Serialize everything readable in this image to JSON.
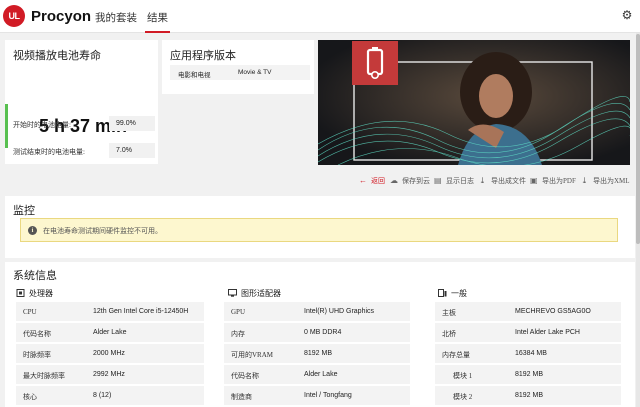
{
  "header": {
    "logo_text": "UL",
    "brand": "Procyon",
    "nav": [
      "我的套装",
      "结果"
    ],
    "settings_icon": "gear-icon"
  },
  "battery": {
    "title": "视频播放电池寿命",
    "value": "5 h 37 min",
    "rows": [
      {
        "label": "开始时的电池电量:",
        "value": "99.0%"
      },
      {
        "label": "测试结束时的电池电量:",
        "value": "7.0%"
      }
    ]
  },
  "app_version": {
    "title": "应用程序版本",
    "row": {
      "label": "电影和电视",
      "value": "Movie & TV"
    }
  },
  "toolbar": {
    "back": "返回",
    "save_cloud": "保存到云",
    "show_log": "显示日志",
    "export_file": "导出成文件",
    "export_pdf": "导出为PDF",
    "export_xml": "导出为XML"
  },
  "monitor": {
    "title": "监控",
    "alert": "在电池寿命测试期间硬件监控不可用。"
  },
  "system_info": {
    "title": "系统信息",
    "columns": [
      {
        "heading": "处理器",
        "icon": "cpu-icon",
        "rows": [
          {
            "label": "CPU",
            "value": "12th Gen Intel Core i5-12450H"
          },
          {
            "label": "代码名称",
            "value": "Alder Lake"
          },
          {
            "label": "时脉频率",
            "value": "2000 MHz"
          },
          {
            "label": "最大时脉频率",
            "value": "2992 MHz"
          },
          {
            "label": "核心",
            "value": "8 (12)"
          }
        ]
      },
      {
        "heading": "图形适配器",
        "icon": "monitor-icon",
        "rows": [
          {
            "label": "GPU",
            "value": "Intel(R) UHD Graphics"
          },
          {
            "label": "内存",
            "value": "0 MB DDR4"
          },
          {
            "label": "可用的VRAM",
            "value": "8192 MB"
          },
          {
            "label": "代码名称",
            "value": "Alder Lake"
          },
          {
            "label": "制造商",
            "value": "Intel / Tongfang"
          }
        ]
      },
      {
        "heading": "一般",
        "icon": "computer-icon",
        "rows": [
          {
            "label": "主板",
            "value": "MECHREVO GS5AG0O"
          },
          {
            "label": "北桥",
            "value": "Intel Alder Lake PCH"
          },
          {
            "label": "内存总量",
            "value": "16384 MB"
          },
          {
            "label": "模块 1",
            "value": "8192 MB"
          },
          {
            "label": "模块 2",
            "value": "8192 MB"
          }
        ]
      }
    ]
  },
  "colors": {
    "accent": "#d11b25",
    "good": "#58c050",
    "alert_bg": "#fdf7cf"
  }
}
